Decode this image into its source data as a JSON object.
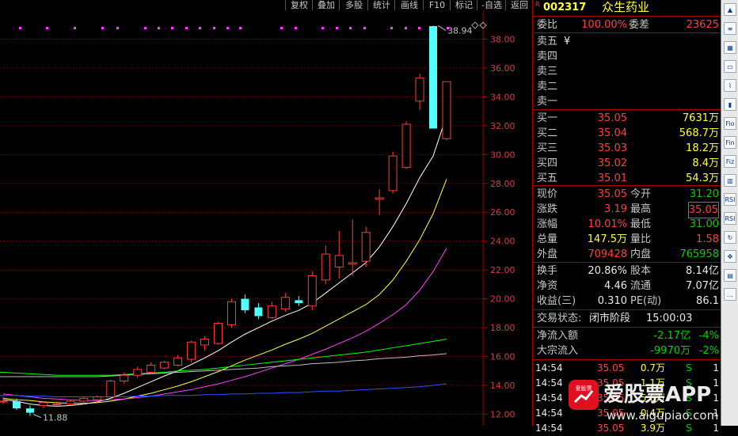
{
  "toolbar": {
    "buttons": [
      "复权",
      "叠加",
      "多股",
      "统计",
      "画线",
      "F10",
      "标记",
      "-自选",
      "返回"
    ]
  },
  "stock": {
    "flag": "R",
    "code": "002317",
    "name": "众生药业"
  },
  "chart_data": {
    "type": "candlestick",
    "ylim": [
      11.2,
      40.0
    ],
    "y_ticks": [
      "38.00",
      "36.00",
      "34.00",
      "32.00",
      "30.00",
      "28.00",
      "26.00",
      "24.00",
      "22.00",
      "20.00",
      "18.00",
      "16.00",
      "14.00",
      "12.00"
    ],
    "high_label": "38.94",
    "low_label": "11.88",
    "candles": [
      {
        "o": 12.9,
        "h": 13.2,
        "l": 12.7,
        "c": 12.9
      },
      {
        "o": 12.9,
        "h": 13.1,
        "l": 12.3,
        "c": 12.4
      },
      {
        "o": 12.4,
        "h": 12.6,
        "l": 11.88,
        "c": 12.1
      },
      {
        "o": 12.6,
        "h": 12.9,
        "l": 12.4,
        "c": 12.8
      },
      {
        "o": 12.7,
        "h": 12.9,
        "l": 12.5,
        "c": 12.7
      },
      {
        "o": 12.7,
        "h": 13.0,
        "l": 12.6,
        "c": 12.9
      },
      {
        "o": 12.9,
        "h": 13.2,
        "l": 12.7,
        "c": 13.1
      },
      {
        "o": 13.0,
        "h": 13.3,
        "l": 12.8,
        "c": 13.2
      },
      {
        "o": 13.2,
        "h": 14.4,
        "l": 13.1,
        "c": 14.3
      },
      {
        "o": 14.3,
        "h": 14.9,
        "l": 14.1,
        "c": 14.7
      },
      {
        "o": 14.7,
        "h": 15.3,
        "l": 14.5,
        "c": 15.1
      },
      {
        "o": 14.9,
        "h": 15.6,
        "l": 14.8,
        "c": 15.4
      },
      {
        "o": 15.2,
        "h": 15.7,
        "l": 15.1,
        "c": 15.6
      },
      {
        "o": 15.4,
        "h": 16.1,
        "l": 15.3,
        "c": 15.9
      },
      {
        "o": 15.8,
        "h": 17.1,
        "l": 15.6,
        "c": 17.0
      },
      {
        "o": 16.8,
        "h": 17.4,
        "l": 16.4,
        "c": 17.2
      },
      {
        "o": 16.9,
        "h": 18.4,
        "l": 16.8,
        "c": 18.3
      },
      {
        "o": 18.2,
        "h": 20.0,
        "l": 18.0,
        "c": 19.8
      },
      {
        "o": 20.0,
        "h": 20.3,
        "l": 19.0,
        "c": 19.2
      },
      {
        "o": 19.4,
        "h": 19.7,
        "l": 18.6,
        "c": 18.8
      },
      {
        "o": 18.7,
        "h": 19.8,
        "l": 18.6,
        "c": 19.5
      },
      {
        "o": 19.3,
        "h": 20.4,
        "l": 19.1,
        "c": 20.1
      },
      {
        "o": 19.9,
        "h": 20.2,
        "l": 19.5,
        "c": 19.7
      },
      {
        "o": 19.5,
        "h": 21.9,
        "l": 19.2,
        "c": 21.6
      },
      {
        "o": 21.3,
        "h": 23.7,
        "l": 21.0,
        "c": 23.1
      },
      {
        "o": 22.2,
        "h": 24.7,
        "l": 21.4,
        "c": 23.0
      },
      {
        "o": 22.4,
        "h": 25.5,
        "l": 21.6,
        "c": 22.5
      },
      {
        "o": 22.6,
        "h": 25.0,
        "l": 22.2,
        "c": 24.6
      },
      {
        "o": 26.9,
        "h": 27.6,
        "l": 25.8,
        "c": 27.0
      },
      {
        "o": 27.5,
        "h": 30.2,
        "l": 27.3,
        "c": 29.9
      },
      {
        "o": 29.1,
        "h": 32.3,
        "l": 29.0,
        "c": 32.1
      },
      {
        "o": 33.7,
        "h": 35.6,
        "l": 33.1,
        "c": 35.3
      },
      {
        "o": 38.9,
        "h": 38.94,
        "l": 31.8,
        "c": 31.8
      },
      {
        "o": 31.1,
        "h": 35.05,
        "l": 31.0,
        "c": 35.05
      }
    ],
    "ma_series": [
      {
        "color": "#ffffff",
        "values": [
          13.0,
          12.9,
          12.7,
          12.6,
          12.55,
          12.6,
          12.7,
          12.85,
          13.1,
          13.45,
          13.85,
          14.25,
          14.65,
          15.0,
          15.45,
          15.9,
          16.4,
          17.0,
          17.55,
          18.0,
          18.45,
          18.85,
          19.2,
          19.7,
          20.4,
          21.1,
          21.8,
          22.5,
          23.6,
          25.0,
          26.6,
          28.4,
          29.9,
          32.7
        ]
      },
      {
        "color": "#ffff40",
        "values": [
          13.1,
          13.0,
          12.95,
          12.85,
          12.8,
          12.75,
          12.75,
          12.8,
          12.9,
          13.05,
          13.25,
          13.45,
          13.7,
          13.95,
          14.25,
          14.6,
          14.95,
          15.35,
          15.75,
          16.1,
          16.45,
          16.85,
          17.2,
          17.6,
          18.1,
          18.6,
          19.1,
          19.6,
          20.3,
          21.3,
          22.6,
          24.1,
          25.9,
          28.3
        ]
      },
      {
        "color": "#ff40ff",
        "values": [
          13.4,
          13.3,
          13.2,
          13.1,
          13.05,
          13.0,
          12.95,
          12.95,
          13.0,
          13.05,
          13.15,
          13.25,
          13.4,
          13.55,
          13.7,
          13.9,
          14.1,
          14.35,
          14.6,
          14.9,
          15.2,
          15.5,
          15.8,
          16.15,
          16.5,
          16.9,
          17.3,
          17.75,
          18.3,
          18.9,
          19.6,
          20.6,
          21.9,
          23.5
        ]
      },
      {
        "color": "#00ff00",
        "values": [
          14.9,
          14.85,
          14.8,
          14.75,
          14.7,
          14.7,
          14.7,
          14.7,
          14.7,
          14.75,
          14.8,
          14.85,
          14.9,
          15.0,
          15.05,
          15.1,
          15.2,
          15.3,
          15.4,
          15.5,
          15.6,
          15.7,
          15.8,
          15.9,
          16.0,
          16.1,
          16.2,
          16.3,
          16.45,
          16.6,
          16.75,
          16.9,
          17.05,
          17.2
        ]
      },
      {
        "color": "#c0c0c0",
        "values": [
          14.6,
          14.6,
          14.6,
          14.6,
          14.6,
          14.6,
          14.6,
          14.6,
          14.65,
          14.7,
          14.75,
          14.8,
          14.85,
          14.9,
          14.95,
          15.0,
          15.05,
          15.1,
          15.15,
          15.2,
          15.3,
          15.35,
          15.4,
          15.5,
          15.55,
          15.6,
          15.7,
          15.75,
          15.85,
          15.9,
          15.95,
          16.05,
          16.1,
          16.2
        ]
      },
      {
        "color": "#3050ff",
        "values": [
          13.3,
          13.3,
          13.25,
          13.25,
          13.2,
          13.2,
          13.2,
          13.2,
          13.2,
          13.2,
          13.25,
          13.25,
          13.3,
          13.3,
          13.3,
          13.35,
          13.35,
          13.4,
          13.4,
          13.45,
          13.45,
          13.5,
          13.5,
          13.55,
          13.6,
          13.6,
          13.65,
          13.7,
          13.75,
          13.8,
          13.85,
          13.9,
          14.0,
          14.1
        ]
      }
    ]
  },
  "order_book": {
    "weibi_label": "委比",
    "weibi_value": "100.00%",
    "weicha_label": "委差",
    "weicha_value": "23625",
    "sells": [
      {
        "label": "卖五",
        "price": "",
        "vol": "",
        "unit": "¥"
      },
      {
        "label": "卖四",
        "price": "",
        "vol": "",
        "unit": ""
      },
      {
        "label": "卖三",
        "price": "",
        "vol": "",
        "unit": ""
      },
      {
        "label": "卖二",
        "price": "",
        "vol": "",
        "unit": ""
      },
      {
        "label": "卖一",
        "price": "",
        "vol": "",
        "unit": ""
      }
    ],
    "buys": [
      {
        "label": "买一",
        "price": "35.05",
        "vol": "7631万"
      },
      {
        "label": "买二",
        "price": "35.04",
        "vol": "568.7万"
      },
      {
        "label": "买三",
        "price": "35.03",
        "vol": "18.2万"
      },
      {
        "label": "买四",
        "price": "35.02",
        "vol": "8.4万"
      },
      {
        "label": "买五",
        "price": "35.01",
        "vol": "54.3万"
      }
    ]
  },
  "stats": [
    {
      "l1": "现价",
      "v1": "35.05",
      "c1": "red",
      "l2": "今开",
      "v2": "31.20",
      "c2": "green"
    },
    {
      "l1": "涨跌",
      "v1": "3.19",
      "c1": "red",
      "l2": "最高",
      "v2": "35.05",
      "c2": "red"
    },
    {
      "l1": "涨幅",
      "v1": "10.01%",
      "c1": "red",
      "l2": "最低",
      "v2": "31.00",
      "c2": "green"
    },
    {
      "l1": "总量",
      "v1": "147.5万",
      "c1": "yellow",
      "l2": "量比",
      "v2": "1.58",
      "c2": "red"
    },
    {
      "l1": "外盘",
      "v1": "709428",
      "c1": "red",
      "l2": "内盘",
      "v2": "765958",
      "c2": "green"
    }
  ],
  "stats2": [
    {
      "l1": "换手",
      "v1": "20.86%",
      "l2": "股本",
      "v2": "8.14亿"
    },
    {
      "l1": "净资",
      "v1": "4.46",
      "l2": "流通",
      "v2": "7.07亿"
    },
    {
      "l1": "收益(三)",
      "v1": "0.310",
      "l2": "PE(动)",
      "v2": "86.1"
    }
  ],
  "trade_status": {
    "label": "交易状态:",
    "value": "闭市阶段",
    "time": "15:00:03"
  },
  "flows": [
    {
      "label": "净流入额",
      "value": "-2.17亿",
      "pct": "-4%"
    },
    {
      "label": "大宗流入",
      "value": "-9970万",
      "pct": "-2%"
    }
  ],
  "ticks": [
    {
      "time": "14:54",
      "price": "35.05",
      "vol": "0.7万",
      "side": "S",
      "n": "1"
    },
    {
      "time": "14:54",
      "price": "35.05",
      "vol": "1.1万",
      "side": "S",
      "n": "1"
    },
    {
      "time": "14:54",
      "price": "35.05",
      "vol": "5.6万",
      "side": "S",
      "n": "1"
    },
    {
      "time": "14:54",
      "price": "35.05",
      "vol": "0.4万",
      "side": "S",
      "n": "1"
    },
    {
      "time": "14:54",
      "price": "35.05",
      "vol": "3.9万",
      "side": "S",
      "n": "1"
    }
  ],
  "watermark": {
    "brand": "爱股票APP",
    "url": "www.aigupiao.com",
    "logo_text": "爱股票"
  },
  "sidebar": {
    "icons": [
      "arrow-up-icon",
      "list-icon",
      "grid-icon",
      "window-icon",
      "line-chart-icon",
      "candle-icon",
      "f10-icon",
      "fin-icon",
      "fiz-icon",
      "bar-icon",
      "rsi-icon",
      "rsi-label-icon",
      "refresh-icon",
      "move-icon",
      "doc-icon",
      "more-icon"
    ],
    "labels": [
      "▲",
      "≡",
      "▦",
      "▭",
      "⌇",
      "▮",
      "Fio",
      "Fin",
      "Fiz",
      "▥",
      "RSI",
      "RSI",
      "↻",
      "✥",
      "▤",
      "…"
    ]
  }
}
